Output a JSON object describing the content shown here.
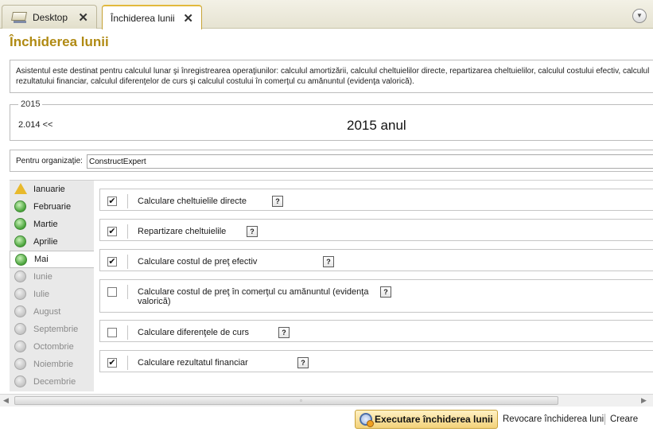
{
  "tabs": [
    {
      "label": "Desktop",
      "icon": "desktop-icon",
      "close_symbol": "✕"
    },
    {
      "label": "Închiderea lunii",
      "close_symbol": "✕"
    }
  ],
  "window_menu_icon": "chevron-down-icon",
  "page": {
    "title": "Închiderea lunii",
    "description": "Asistentul este destinat pentru calculul lunar şi înregistrearea operaţiunilor: calculul amortizării, calculul cheltuielilor directe, repartizarea cheltuielilor, calculul costului efectiv, calculul rezultatului financiar, calculul diferenţelor de curs şi calculul costului  în comerţul cu amănuntul (evidenţa valorică)."
  },
  "year": {
    "legend": "2015",
    "prev_link": "2.014 <<",
    "title": "2015 anul"
  },
  "organization": {
    "label": "Pentru organizaţie:",
    "value": "ConstructExpert"
  },
  "months": [
    {
      "label": "Ianuarie",
      "status": "warning"
    },
    {
      "label": "Februarie",
      "status": "done"
    },
    {
      "label": "Martie",
      "status": "done"
    },
    {
      "label": "Aprilie",
      "status": "done"
    },
    {
      "label": "Mai",
      "status": "done",
      "selected": true
    },
    {
      "label": "Iunie",
      "status": "pending"
    },
    {
      "label": "Iulie",
      "status": "pending"
    },
    {
      "label": "August",
      "status": "pending"
    },
    {
      "label": "Septembrie",
      "status": "pending"
    },
    {
      "label": "Octombrie",
      "status": "pending"
    },
    {
      "label": "Noiembrie",
      "status": "pending"
    },
    {
      "label": "Decembrie",
      "status": "pending"
    }
  ],
  "operations": [
    {
      "label": "Calculare cheltuielile directe",
      "checked": true
    },
    {
      "label": "Repartizare cheltuielile",
      "checked": true
    },
    {
      "label": "Calculare costul de preţ efectiv",
      "checked": true
    },
    {
      "label": "Calculare costul de preţ în comerţul cu amănuntul (evidenţa valorică)",
      "checked": false
    },
    {
      "label": "Calculare diferenţele de curs",
      "checked": false
    },
    {
      "label": "Calculare rezultatul financiar",
      "checked": true
    }
  ],
  "help_symbol": "?",
  "check_symbol": "✔",
  "actions": {
    "execute": "Executare închiderea lunii",
    "revoke": "Revocare închiderea lunii",
    "create": "Creare"
  },
  "scroll": {
    "left_arrow": "◀",
    "right_arrow": "▶",
    "grip": "▫"
  }
}
